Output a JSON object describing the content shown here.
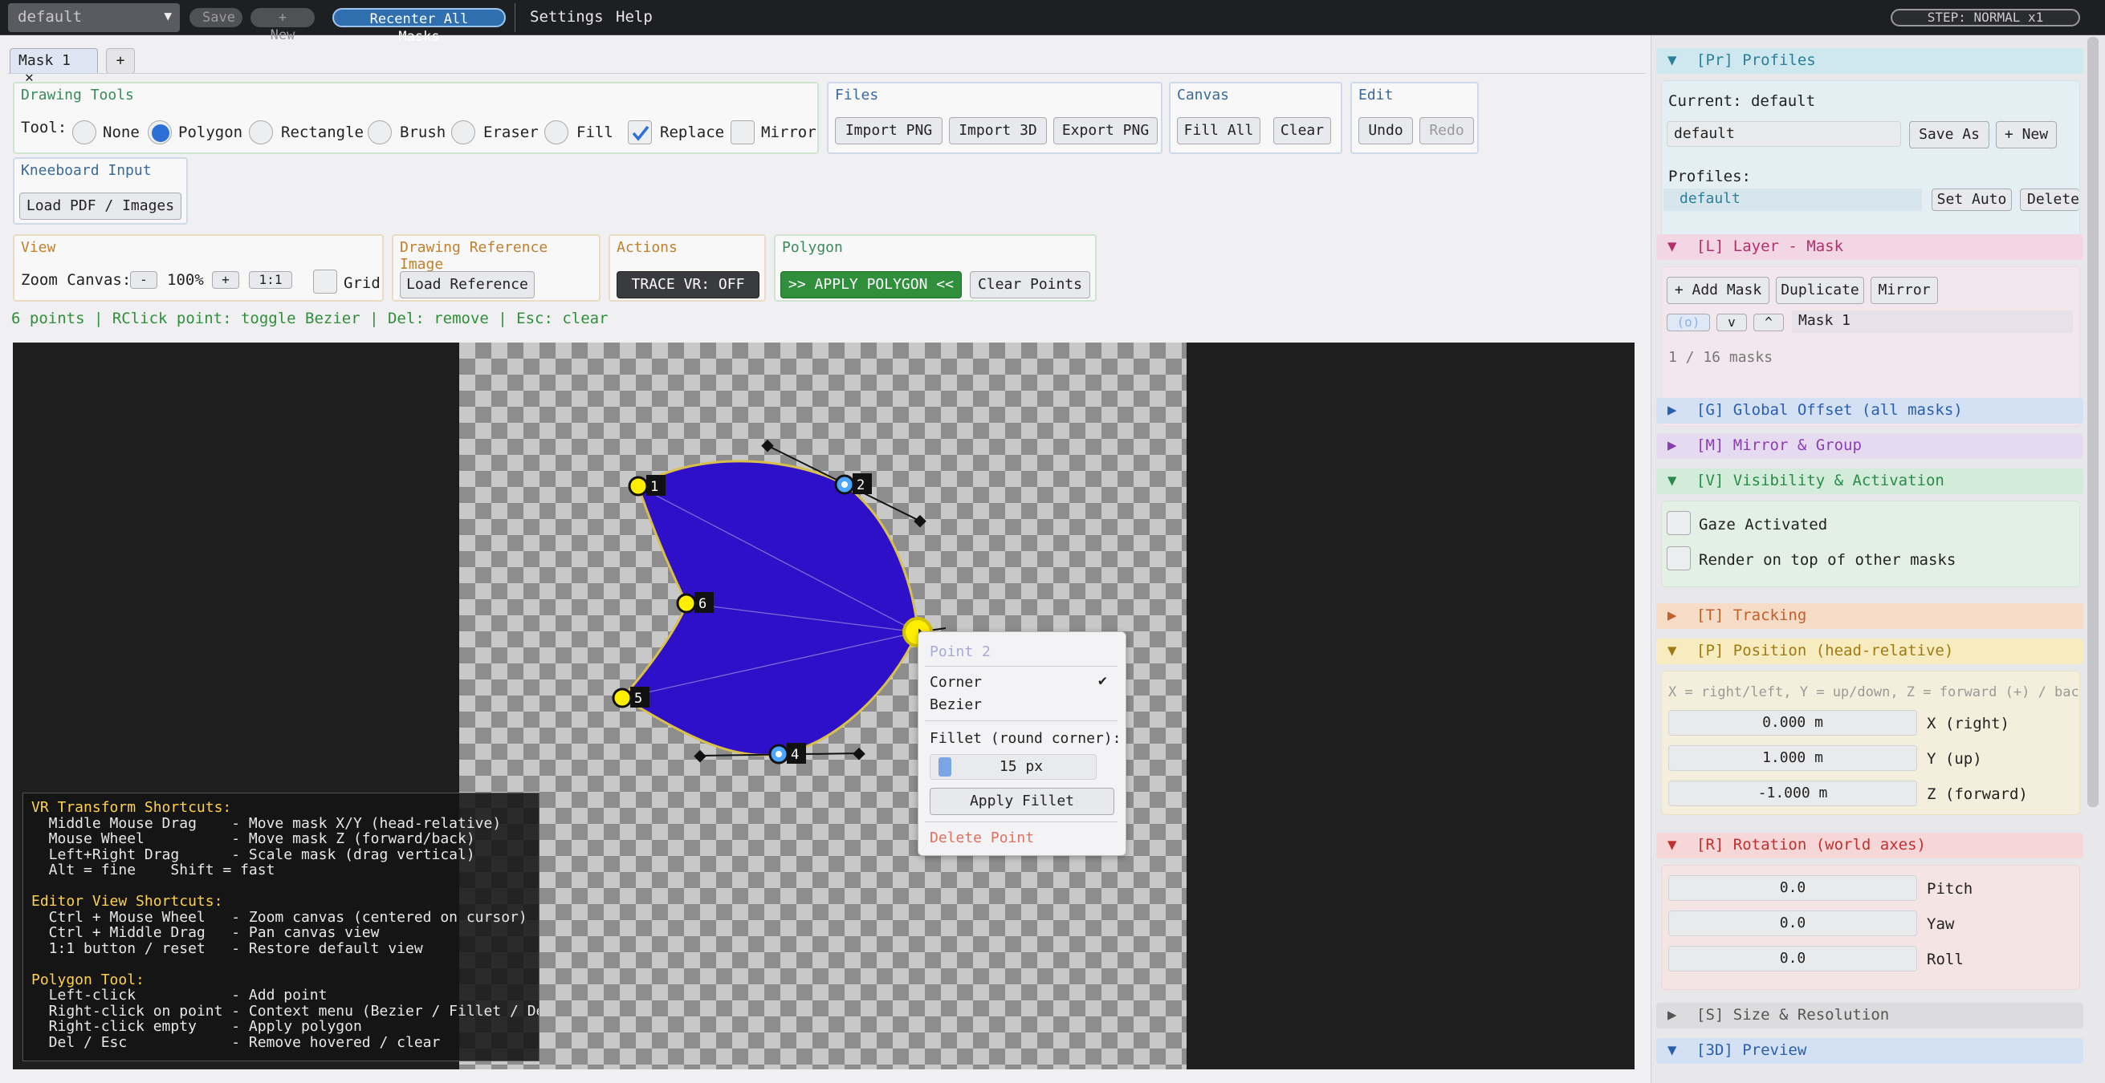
{
  "topbar": {
    "profile": "default",
    "save": "Save",
    "new": "+ New",
    "recenter": "Recenter All Masks",
    "menu_settings": "Settings",
    "menu_help": "Help",
    "step": "STEP: NORMAL  x1"
  },
  "tabs": {
    "mask_tab": "Mask 1",
    "close": "✕",
    "add": "+"
  },
  "drawing_tools": {
    "title": "Drawing Tools",
    "tool_label": "Tool:",
    "none": "None",
    "polygon": "Polygon",
    "rectangle": "Rectangle",
    "brush": "Brush",
    "eraser": "Eraser",
    "fill": "Fill",
    "replace": "Replace",
    "mirror": "Mirror",
    "selected": "Polygon"
  },
  "files": {
    "title": "Files",
    "import_png": "Import PNG",
    "import_3d": "Import 3D",
    "export_png": "Export PNG"
  },
  "canvas_grp": {
    "title": "Canvas",
    "fill_all": "Fill All",
    "clear": "Clear"
  },
  "edit": {
    "title": "Edit",
    "undo": "Undo",
    "redo": "Redo"
  },
  "kneeboard": {
    "title": "Kneeboard Input",
    "load": "Load PDF / Images"
  },
  "view": {
    "title": "View",
    "zoom_label": "Zoom Canvas:",
    "minus": "-",
    "zoom": "100%",
    "plus": "+",
    "reset": "1:1",
    "grid": "Grid"
  },
  "ref": {
    "title": "Drawing Reference Image",
    "load": "Load Reference"
  },
  "actions": {
    "title": "Actions",
    "trace": "TRACE VR: OFF"
  },
  "polygon": {
    "title": "Polygon",
    "apply": ">> APPLY POLYGON <<",
    "clear": "Clear Points"
  },
  "status": "6 points | RClick point: toggle Bezier | Del: remove | Esc: clear",
  "points": [
    "1",
    "2",
    "4",
    "5",
    "6"
  ],
  "shortcuts": {
    "h1": "VR Transform Shortcuts:",
    "l1": "  Middle Mouse Drag    - Move mask X/Y (head-relative)",
    "l2": "  Mouse Wheel          - Move mask Z (forward/back)",
    "l3": "  Left+Right Drag      - Scale mask (drag vertical)",
    "l4": "  Alt = fine    Shift = fast",
    "h2": "Editor View Shortcuts:",
    "l5": "  Ctrl + Mouse Wheel   - Zoom canvas (centered on cursor)",
    "l6": "  Ctrl + Middle Drag   - Pan canvas view",
    "l7": "  1:1 button / reset   - Restore default view",
    "h3": "Polygon Tool:",
    "l8": "  Left-click           - Add point",
    "l9": "  Right-click on point - Context menu (Bezier / Fillet / Delete)",
    "l10": "  Right-click empty    - Apply polygon",
    "l11": "  Del / Esc            - Remove hovered / clear"
  },
  "context_menu": {
    "title": "Point 2",
    "corner": "Corner",
    "check": "✔",
    "bezier": "Bezier",
    "fillet_label": "Fillet (round corner):",
    "fillet_value": "15 px",
    "apply": "Apply Fillet",
    "delete": "Delete Point"
  },
  "panel": {
    "profiles": {
      "header": "[Pr] Profiles",
      "current": "Current: default",
      "name_value": "default",
      "save_as": "Save As",
      "new": "+ New",
      "list_label": "Profiles:",
      "item": "default",
      "set_auto": "Set Auto",
      "delete": "Delete"
    },
    "layer": {
      "header": "[L] Layer - Mask",
      "add": "+ Add Mask",
      "duplicate": "Duplicate",
      "mirror": "Mirror",
      "vis": "(o)",
      "down": "v",
      "up": "^",
      "item": "Mask 1",
      "count": "1 / 16 masks"
    },
    "global": "[G] Global Offset (all masks)",
    "mirror_group": "[M] Mirror & Group",
    "visibility": {
      "header": "[V] Visibility & Activation",
      "gaze": "Gaze Activated",
      "render_top": "Render on top of other masks"
    },
    "tracking": "[T] Tracking",
    "position": {
      "header": "[P] Position (head-relative)",
      "hint": "X = right/left, Y = up/down, Z = forward (+) / back",
      "x": "0.000 m",
      "x_label": "X (right)",
      "y": "1.000 m",
      "y_label": "Y (up)",
      "z": "-1.000 m",
      "z_label": "Z (forward)"
    },
    "rotation": {
      "header": "[R] Rotation (world axes)",
      "pitch": "0.0",
      "pitch_label": "Pitch",
      "yaw": "0.0",
      "yaw_label": "Yaw",
      "roll": "0.0",
      "roll_label": "Roll"
    },
    "size": "[S] Size & Resolution",
    "preview": "[3D] Preview",
    "arrows": {
      "open": "▼",
      "closed": "▶"
    }
  },
  "colors": {
    "accent": "#2c6fd6",
    "polygon_fill": "#2d10c8",
    "apply_green": "#2f8f3a",
    "point_yellow": "#ffee00",
    "point_blue": "#4aa6ff"
  }
}
